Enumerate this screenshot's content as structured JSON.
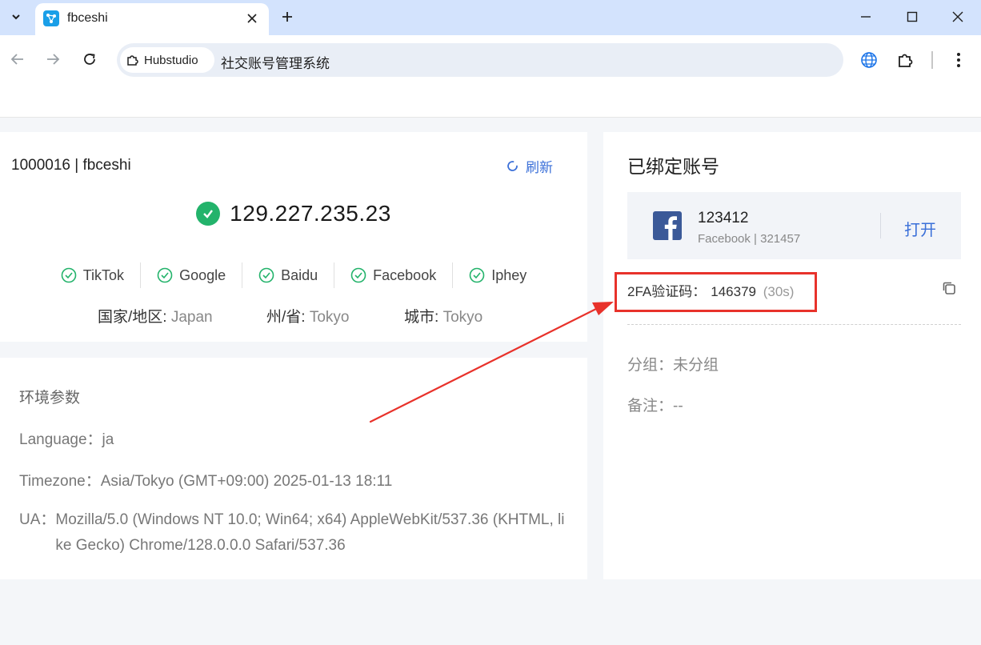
{
  "browser": {
    "tab_title": "fbceshi",
    "omnibox_chip": "Hubstudio",
    "omnibox_text": "社交账号管理系统"
  },
  "env": {
    "id_label": "1000016 | fbceshi",
    "refresh_label": "刷新",
    "ip": "129.227.235.23",
    "sites": [
      "TikTok",
      "Google",
      "Baidu",
      "Facebook",
      "Iphey"
    ],
    "country_key": "国家/地区: ",
    "country_val": "Japan",
    "state_key": "州/省: ",
    "state_val": "Tokyo",
    "city_key": "城市: ",
    "city_val": "Tokyo"
  },
  "params": {
    "title": "环境参数",
    "language": "Language：ja",
    "timezone": "Timezone：Asia/Tokyo (GMT+09:00) 2025-01-13 18:11",
    "ua_key": "UA：",
    "ua_val": "Mozilla/5.0 (Windows NT 10.0; Win64; x64) AppleWebKit/537.36 (KHTML, like Gecko) Chrome/128.0.0.0 Safari/537.36"
  },
  "account": {
    "title": "已绑定账号",
    "name": "123412",
    "sub": "Facebook | 321457",
    "open_label": "打开",
    "twofa_label": "2FA验证码：",
    "twofa_code": "146379",
    "twofa_timer": "(30s)",
    "group": "分组：未分组",
    "note": "备注：--"
  },
  "colors": {
    "accent": "#3a6fd8",
    "success": "#23b36b",
    "annotation": "#e8322b",
    "facebook": "#3b5998"
  }
}
